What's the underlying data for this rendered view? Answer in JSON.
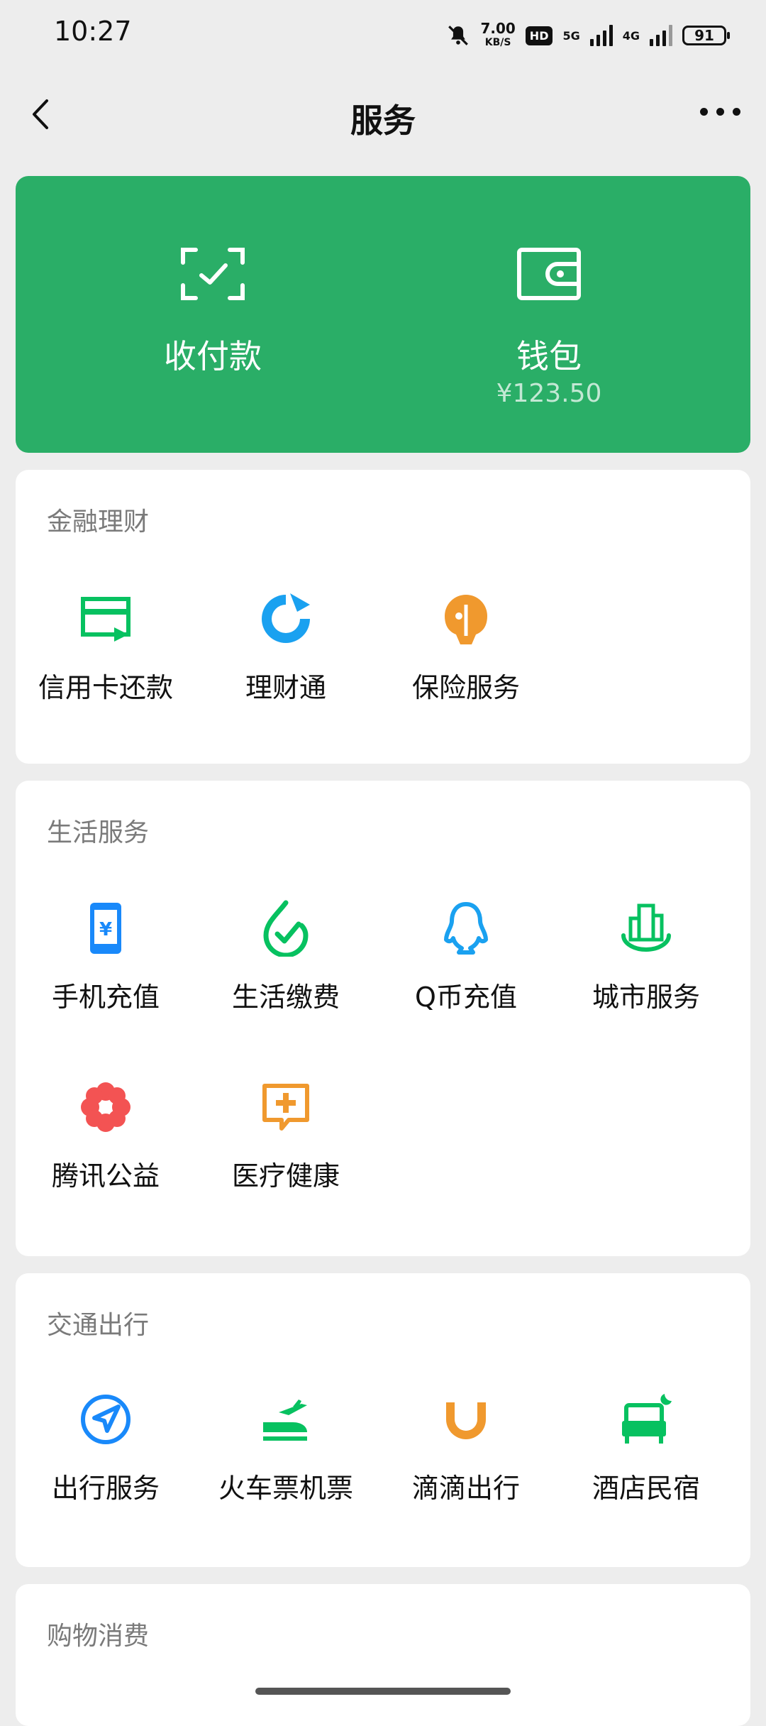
{
  "status_bar": {
    "time": "10:27",
    "speed_value": "7.00",
    "speed_unit": "KB/S",
    "hd_badge": "HD",
    "network_5g": "5G",
    "network_4g": "4G",
    "battery": "91"
  },
  "header": {
    "title": "服务"
  },
  "pay_card": {
    "color": "#2aae67",
    "pay_label": "收付款",
    "wallet_label": "钱包",
    "wallet_balance": "¥123.50"
  },
  "sections": [
    {
      "title": "金融理财",
      "items": [
        {
          "label": "信用卡还款",
          "icon": "credit-card-icon",
          "color": "#07c160"
        },
        {
          "label": "理财通",
          "icon": "wealth-icon",
          "color": "#1aa1f0"
        },
        {
          "label": "保险服务",
          "icon": "insurance-icon",
          "color": "#f0992e"
        }
      ]
    },
    {
      "title": "生活服务",
      "items": [
        {
          "label": "手机充值",
          "icon": "phone-recharge-icon",
          "color": "#1989fa"
        },
        {
          "label": "生活缴费",
          "icon": "utility-bill-icon",
          "color": "#07c160"
        },
        {
          "label": "Q币充值",
          "icon": "qq-coin-icon",
          "color": "#1aa1f0"
        },
        {
          "label": "城市服务",
          "icon": "city-service-icon",
          "color": "#07c160"
        },
        {
          "label": "腾讯公益",
          "icon": "charity-flower-icon",
          "color": "#f35353"
        },
        {
          "label": "医疗健康",
          "icon": "medical-icon",
          "color": "#f0992e"
        }
      ]
    },
    {
      "title": "交通出行",
      "items": [
        {
          "label": "出行服务",
          "icon": "travel-navigation-icon",
          "color": "#1989fa"
        },
        {
          "label": "火车票机票",
          "icon": "train-plane-icon",
          "color": "#07c160"
        },
        {
          "label": "滴滴出行",
          "icon": "didi-icon",
          "color": "#f0992e"
        },
        {
          "label": "酒店民宿",
          "icon": "hotel-bed-icon",
          "color": "#07c160"
        }
      ]
    },
    {
      "title": "购物消费",
      "items": []
    }
  ]
}
